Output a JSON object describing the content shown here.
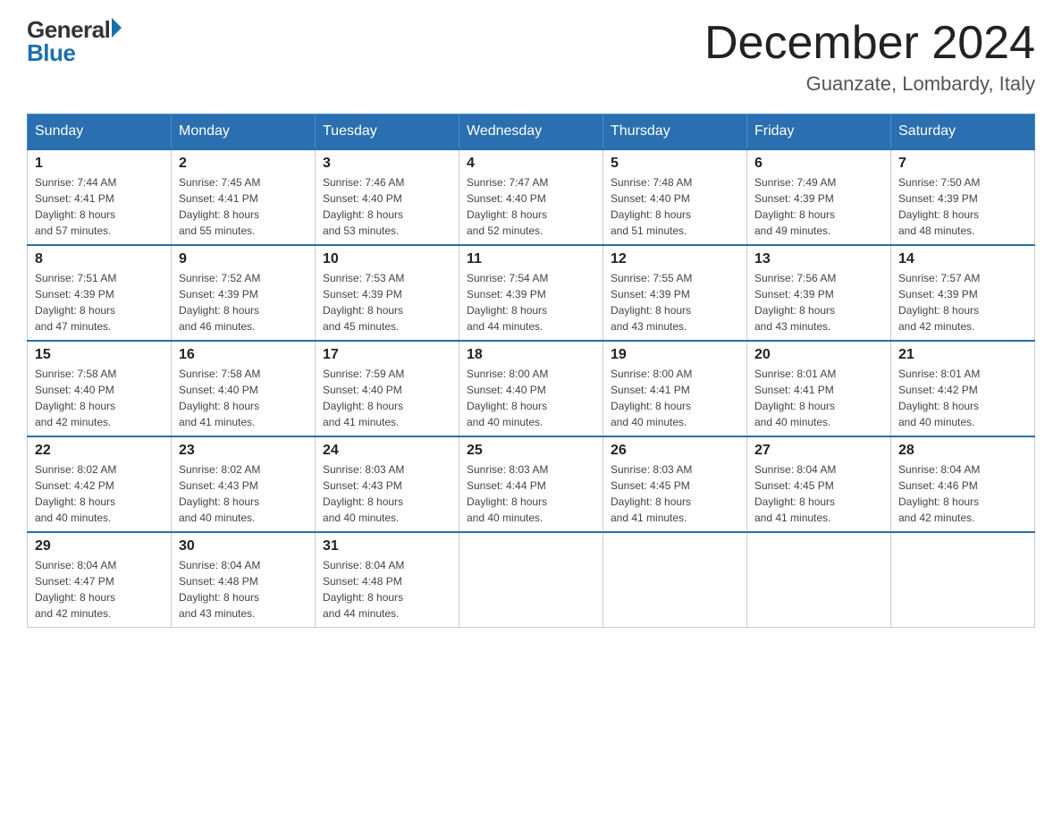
{
  "logo": {
    "general": "General",
    "blue": "Blue"
  },
  "title": "December 2024",
  "location": "Guanzate, Lombardy, Italy",
  "days_of_week": [
    "Sunday",
    "Monday",
    "Tuesday",
    "Wednesday",
    "Thursday",
    "Friday",
    "Saturday"
  ],
  "weeks": [
    [
      {
        "day": "1",
        "sunrise": "7:44 AM",
        "sunset": "4:41 PM",
        "daylight": "8 hours and 57 minutes."
      },
      {
        "day": "2",
        "sunrise": "7:45 AM",
        "sunset": "4:41 PM",
        "daylight": "8 hours and 55 minutes."
      },
      {
        "day": "3",
        "sunrise": "7:46 AM",
        "sunset": "4:40 PM",
        "daylight": "8 hours and 53 minutes."
      },
      {
        "day": "4",
        "sunrise": "7:47 AM",
        "sunset": "4:40 PM",
        "daylight": "8 hours and 52 minutes."
      },
      {
        "day": "5",
        "sunrise": "7:48 AM",
        "sunset": "4:40 PM",
        "daylight": "8 hours and 51 minutes."
      },
      {
        "day": "6",
        "sunrise": "7:49 AM",
        "sunset": "4:39 PM",
        "daylight": "8 hours and 49 minutes."
      },
      {
        "day": "7",
        "sunrise": "7:50 AM",
        "sunset": "4:39 PM",
        "daylight": "8 hours and 48 minutes."
      }
    ],
    [
      {
        "day": "8",
        "sunrise": "7:51 AM",
        "sunset": "4:39 PM",
        "daylight": "8 hours and 47 minutes."
      },
      {
        "day": "9",
        "sunrise": "7:52 AM",
        "sunset": "4:39 PM",
        "daylight": "8 hours and 46 minutes."
      },
      {
        "day": "10",
        "sunrise": "7:53 AM",
        "sunset": "4:39 PM",
        "daylight": "8 hours and 45 minutes."
      },
      {
        "day": "11",
        "sunrise": "7:54 AM",
        "sunset": "4:39 PM",
        "daylight": "8 hours and 44 minutes."
      },
      {
        "day": "12",
        "sunrise": "7:55 AM",
        "sunset": "4:39 PM",
        "daylight": "8 hours and 43 minutes."
      },
      {
        "day": "13",
        "sunrise": "7:56 AM",
        "sunset": "4:39 PM",
        "daylight": "8 hours and 43 minutes."
      },
      {
        "day": "14",
        "sunrise": "7:57 AM",
        "sunset": "4:39 PM",
        "daylight": "8 hours and 42 minutes."
      }
    ],
    [
      {
        "day": "15",
        "sunrise": "7:58 AM",
        "sunset": "4:40 PM",
        "daylight": "8 hours and 42 minutes."
      },
      {
        "day": "16",
        "sunrise": "7:58 AM",
        "sunset": "4:40 PM",
        "daylight": "8 hours and 41 minutes."
      },
      {
        "day": "17",
        "sunrise": "7:59 AM",
        "sunset": "4:40 PM",
        "daylight": "8 hours and 41 minutes."
      },
      {
        "day": "18",
        "sunrise": "8:00 AM",
        "sunset": "4:40 PM",
        "daylight": "8 hours and 40 minutes."
      },
      {
        "day": "19",
        "sunrise": "8:00 AM",
        "sunset": "4:41 PM",
        "daylight": "8 hours and 40 minutes."
      },
      {
        "day": "20",
        "sunrise": "8:01 AM",
        "sunset": "4:41 PM",
        "daylight": "8 hours and 40 minutes."
      },
      {
        "day": "21",
        "sunrise": "8:01 AM",
        "sunset": "4:42 PM",
        "daylight": "8 hours and 40 minutes."
      }
    ],
    [
      {
        "day": "22",
        "sunrise": "8:02 AM",
        "sunset": "4:42 PM",
        "daylight": "8 hours and 40 minutes."
      },
      {
        "day": "23",
        "sunrise": "8:02 AM",
        "sunset": "4:43 PM",
        "daylight": "8 hours and 40 minutes."
      },
      {
        "day": "24",
        "sunrise": "8:03 AM",
        "sunset": "4:43 PM",
        "daylight": "8 hours and 40 minutes."
      },
      {
        "day": "25",
        "sunrise": "8:03 AM",
        "sunset": "4:44 PM",
        "daylight": "8 hours and 40 minutes."
      },
      {
        "day": "26",
        "sunrise": "8:03 AM",
        "sunset": "4:45 PM",
        "daylight": "8 hours and 41 minutes."
      },
      {
        "day": "27",
        "sunrise": "8:04 AM",
        "sunset": "4:45 PM",
        "daylight": "8 hours and 41 minutes."
      },
      {
        "day": "28",
        "sunrise": "8:04 AM",
        "sunset": "4:46 PM",
        "daylight": "8 hours and 42 minutes."
      }
    ],
    [
      {
        "day": "29",
        "sunrise": "8:04 AM",
        "sunset": "4:47 PM",
        "daylight": "8 hours and 42 minutes."
      },
      {
        "day": "30",
        "sunrise": "8:04 AM",
        "sunset": "4:48 PM",
        "daylight": "8 hours and 43 minutes."
      },
      {
        "day": "31",
        "sunrise": "8:04 AM",
        "sunset": "4:48 PM",
        "daylight": "8 hours and 44 minutes."
      },
      null,
      null,
      null,
      null
    ]
  ],
  "labels": {
    "sunrise": "Sunrise:",
    "sunset": "Sunset:",
    "daylight": "Daylight:"
  }
}
